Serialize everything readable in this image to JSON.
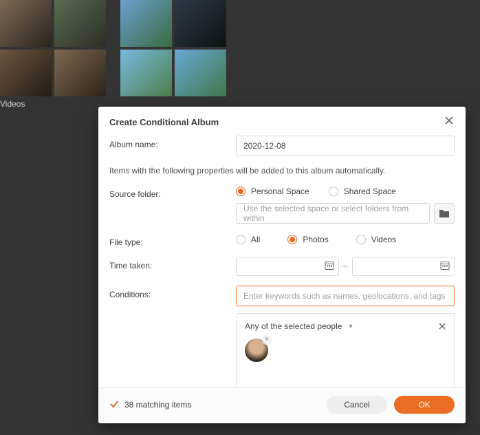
{
  "background": {
    "label_videos": "Videos"
  },
  "modal": {
    "title": "Create Conditional Album",
    "labels": {
      "album_name": "Album name:",
      "helper": "Items with the following properties will be added to this album automatically.",
      "source_folder": "Source folder:",
      "file_type": "File type:",
      "time_taken": "Time taken:",
      "conditions": "Conditions:"
    },
    "album_name_value": "2020-12-08",
    "source": {
      "options": [
        "Personal Space",
        "Shared Space"
      ],
      "selected": 0,
      "folder_placeholder": "Use the selected space or select folders from within"
    },
    "file_type": {
      "options": [
        "All",
        "Photos",
        "Videos"
      ],
      "selected": 1
    },
    "date_sep": "~",
    "conditions_placeholder": "Enter keywords such as names, geolocations, and tags",
    "people": {
      "dropdown_label": "Any of the selected people"
    },
    "footer": {
      "match_text": "38 matching items",
      "cancel": "Cancel",
      "ok": "OK"
    }
  }
}
